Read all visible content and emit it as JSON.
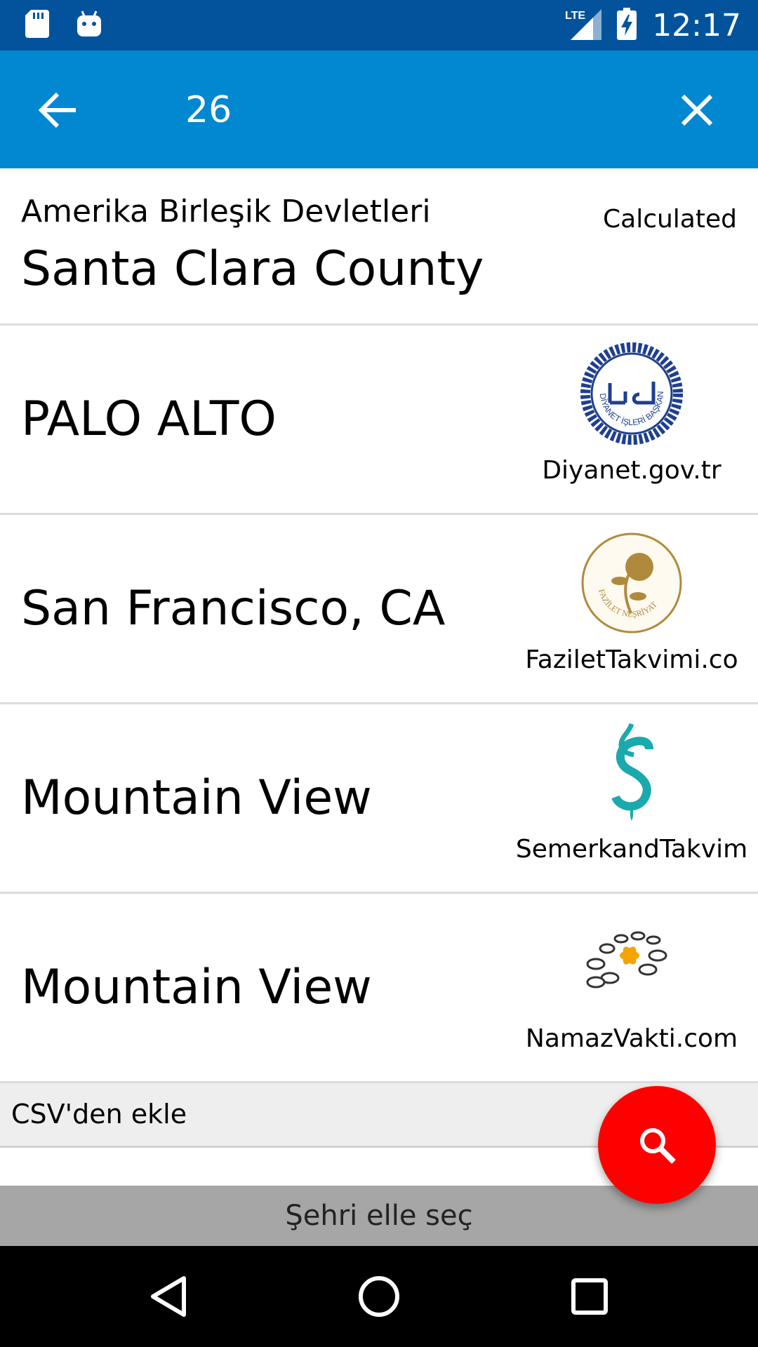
{
  "status_bar": {
    "time": "12:17",
    "network": "LTE",
    "icons": [
      "sd-card-icon",
      "android-debug-icon",
      "lte-signal-icon",
      "battery-charging-icon"
    ]
  },
  "search_bar": {
    "query": "26",
    "back_icon": "arrow-back-icon",
    "clear_icon": "close-icon"
  },
  "header_row": {
    "country": "Amerika Birleşik Devletleri",
    "county": "Santa Clara County",
    "source": "Calculated"
  },
  "results": [
    {
      "city": "PALO ALTO",
      "source": "Diyanet.gov.tr",
      "logo": "diyanet-logo"
    },
    {
      "city": "San Francisco, CA",
      "source": "FaziletTakvimi.co",
      "logo": "fazilet-logo"
    },
    {
      "city": "Mountain View",
      "source": "SemerkandTakvim",
      "logo": "semerkand-logo"
    },
    {
      "city": "Mountain View",
      "source": "NamazVakti.com",
      "logo": "namazvakti-logo"
    }
  ],
  "csv": {
    "label": "CSV'den ekle"
  },
  "manual_select": {
    "label": "Şehri elle seç"
  },
  "fab": {
    "icon": "search-icon"
  },
  "colors": {
    "status_bar": "#02539c",
    "app_bar": "#0288d1",
    "fab": "#ff0000",
    "diyanet_blue": "#1f3f8f",
    "fazilet_gold": "#b08a3c",
    "semerkand_teal": "#1aa9ad",
    "namazvakti_orange": "#f5a300"
  },
  "logo_text": {
    "diyanet": "DİYANET İŞLERİ BAŞKANLIĞI",
    "fazilet": "FAZİLET NEŞRİYAT"
  }
}
